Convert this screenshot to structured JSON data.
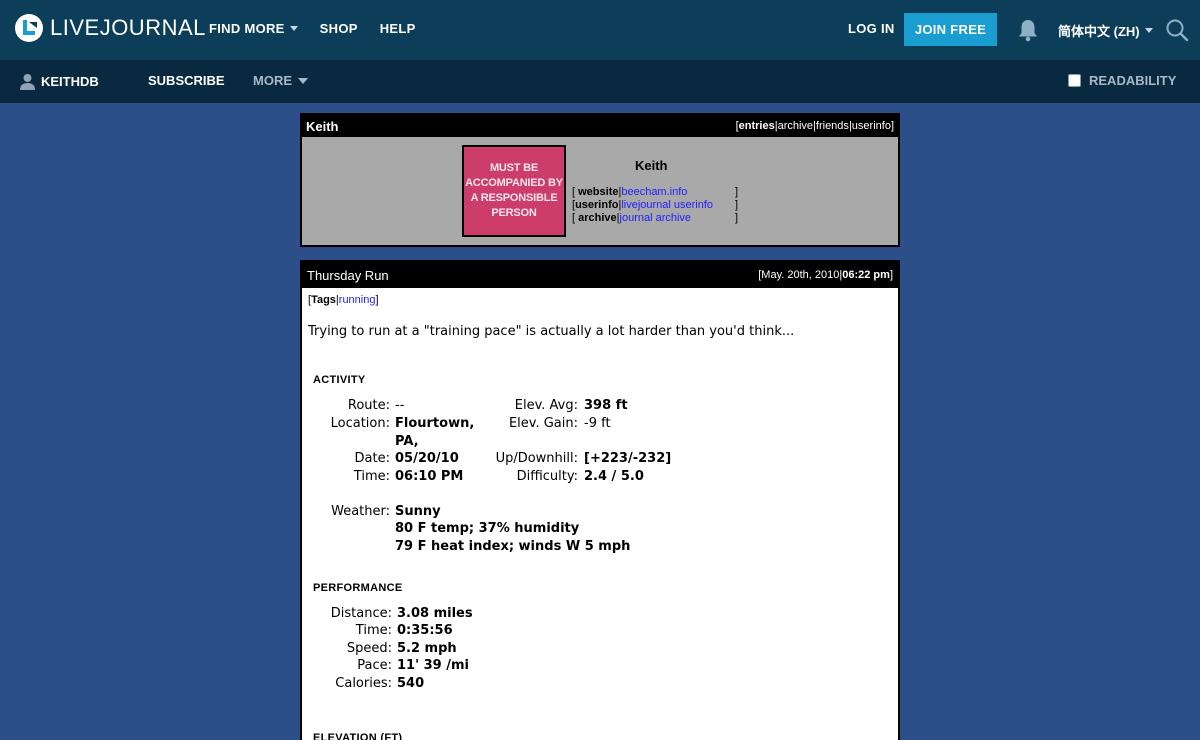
{
  "header": {
    "logo_text": "LIVEJOURNAL",
    "nav": [
      {
        "label": "FIND MORE",
        "has_caret": true
      },
      {
        "label": "SHOP",
        "has_caret": false
      },
      {
        "label": "HELP",
        "has_caret": false
      }
    ],
    "login_label": "LOG IN",
    "join_label": "JOIN FREE",
    "language_label": "简体中文 (ZH)",
    "colors": {
      "topbar": "#0c3e59",
      "subbar": "#08293f",
      "join": "#1a9ed2",
      "page_bg": "#2c4f8a"
    }
  },
  "subbar": {
    "username": "KEITHDB",
    "subscribe_label": "SUBSCRIBE",
    "more_label": "MORE",
    "readability_label": "READABILITY"
  },
  "profile": {
    "header_name": "Keith",
    "nav": {
      "open": "[",
      "entries": "entries",
      "sep": "|",
      "archive": "archive",
      "friends": "friends",
      "userinfo": "userinfo",
      "close": "]"
    },
    "userpic_text": "MUST BE ACCOMPANIED BY A RESPONSIBLE PERSON",
    "title": "Keith",
    "links": [
      {
        "open": "[",
        "label": "website",
        "sep": "|",
        "value": "beecham.info",
        "close": "]"
      },
      {
        "open": "[",
        "label": "userinfo",
        "sep": "|",
        "value": "livejournal userinfo",
        "close": "]"
      },
      {
        "open": "[",
        "label": "archive",
        "sep": "|",
        "value": "journal archive",
        "close": "]"
      }
    ]
  },
  "entry": {
    "title": "Thursday Run",
    "date": "May. 20th, 2010",
    "time": "06:22 pm",
    "tags_label": "Tags",
    "tag": "running",
    "intro": "Trying to run at a \"training pace\" is actually a lot harder than you'd think...",
    "activity_heading": "ACTIVITY",
    "activity_left": [
      {
        "label": "Route:",
        "value": "--"
      },
      {
        "label": "Location:",
        "value": "Flourtown,"
      },
      {
        "label": "",
        "value": "PA,"
      },
      {
        "label": "Date:",
        "value": "05/20/10"
      },
      {
        "label": "Time:",
        "value": "06:10 PM"
      }
    ],
    "activity_right": [
      {
        "label": "Elev. Avg:",
        "value": "398 ft"
      },
      {
        "label": "Elev. Gain:",
        "value": "-9 ft"
      },
      {
        "label": "Up/Downhill:",
        "value": "[+223/-232]"
      },
      {
        "label": "Difficulty:",
        "value": "2.4 / 5.0"
      }
    ],
    "weather_label": "Weather:",
    "weather_lines": [
      "Sunny",
      "80 F temp; 37% humidity",
      "79 F heat index; winds W 5 mph"
    ],
    "performance_heading": "PERFORMANCE",
    "performance": [
      {
        "label": "Distance:",
        "value": "3.08 miles"
      },
      {
        "label": "Time:",
        "value": "0:35:56"
      },
      {
        "label": "Speed:",
        "value": "5.2 mph"
      },
      {
        "label": "Pace:",
        "value": "11' 39 /mi"
      },
      {
        "label": "Calories:",
        "value": "540"
      }
    ],
    "elevation_heading": "ELEVATION (FT)"
  }
}
